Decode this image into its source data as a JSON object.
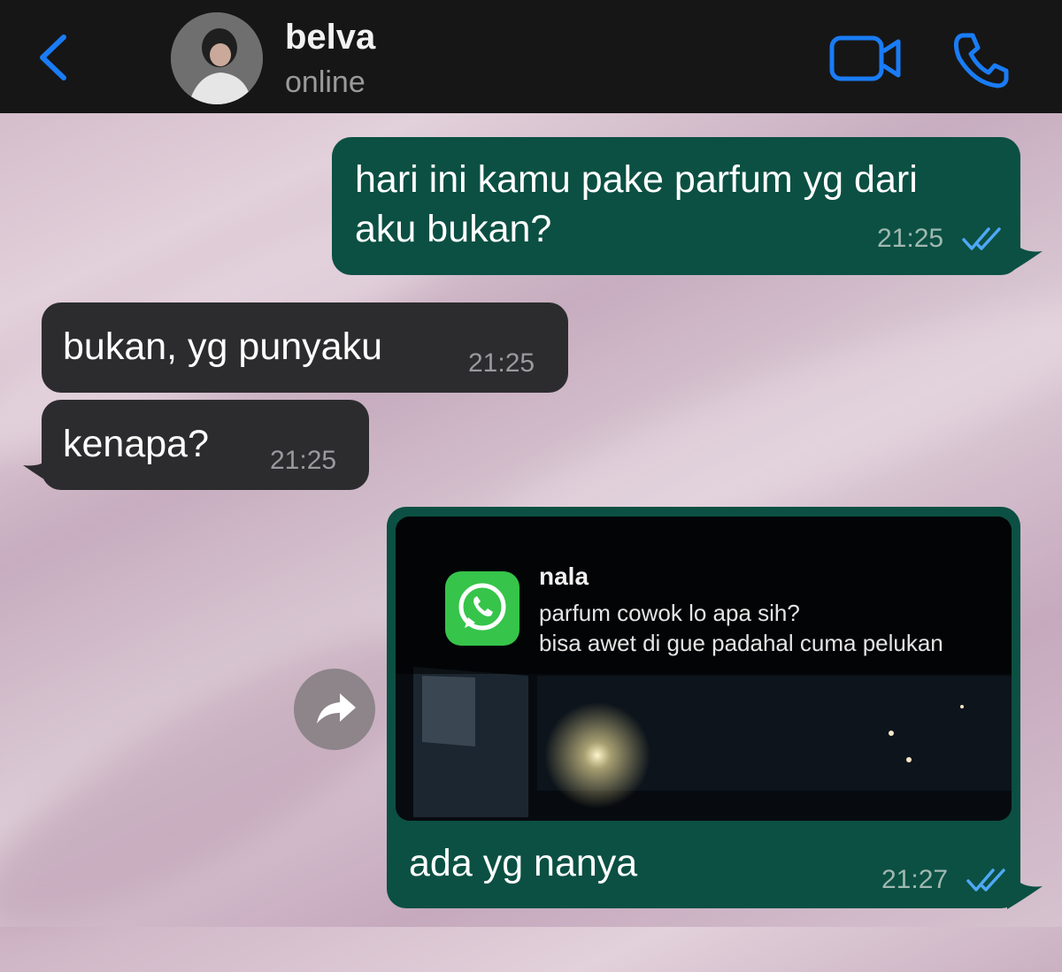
{
  "header": {
    "back_icon": "chevron-left-icon",
    "contact_name": "belva",
    "contact_status": "online",
    "video_icon": "video-camera-icon",
    "call_icon": "phone-icon",
    "accent_color": "#1a7cf5"
  },
  "messages": [
    {
      "direction": "outgoing",
      "lines": [
        "hari ini kamu pake parfum yg dari",
        "aku bukan?"
      ],
      "time": "21:25",
      "status": "read"
    },
    {
      "direction": "incoming",
      "text": "bukan, yg punyaku",
      "time": "21:25"
    },
    {
      "direction": "incoming",
      "text": "kenapa?",
      "time": "21:25"
    },
    {
      "direction": "outgoing",
      "image": {
        "notification": {
          "app_icon": "whatsapp-icon",
          "sender": "nala",
          "lines": [
            "parfum cowok lo apa sih?",
            "bisa awet di gue padahal cuma pelukan"
          ]
        }
      },
      "text": "ada yg nanya",
      "time": "21:27",
      "status": "read"
    }
  ],
  "forward_icon": "forward-arrow-icon",
  "colors": {
    "outgoing_bubble": "#0b5043",
    "incoming_bubble": "#2c2c2e",
    "read_ticks": "#4fa8f5"
  }
}
